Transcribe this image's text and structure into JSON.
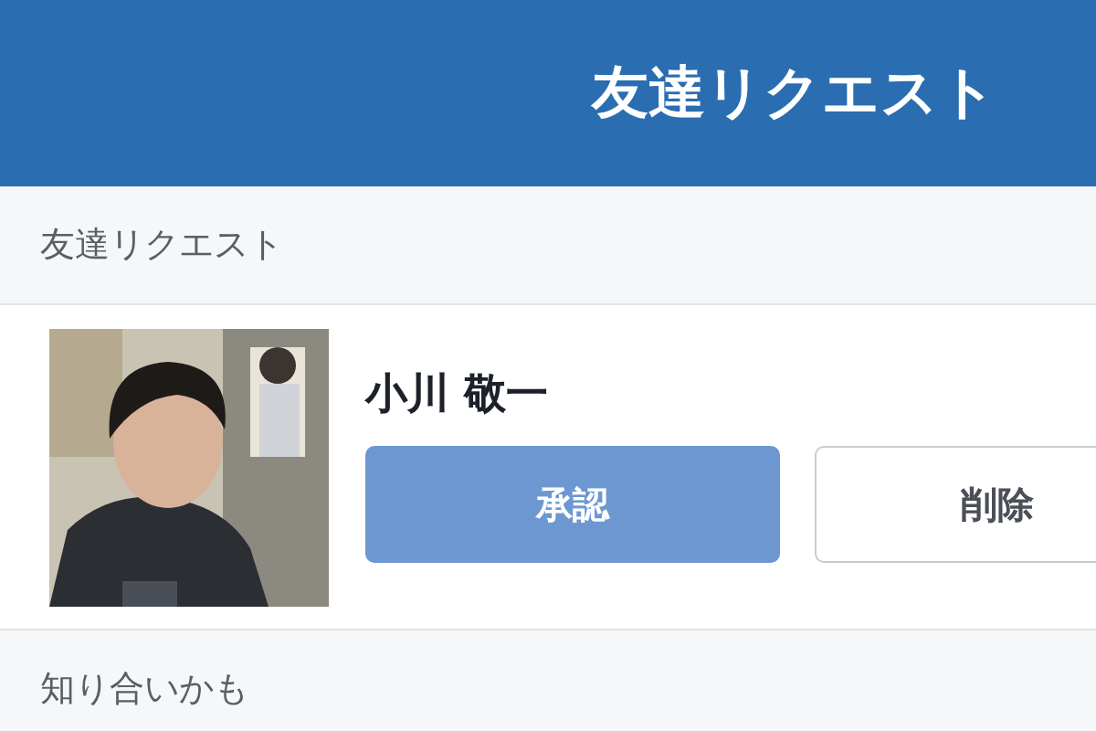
{
  "header": {
    "title": "友達リクエスト"
  },
  "sections": [
    {
      "title": "友達リクエスト",
      "requests": [
        {
          "kind": "picture",
          "name": "小川 敬一",
          "buttons": [
            {
              "label": "承認",
              "primary": true
            },
            {
              "label": "削除",
              "primary": false
            }
          ]
        }
      ]
    },
    {
      "title": "知り合いかも"
    }
  ]
}
